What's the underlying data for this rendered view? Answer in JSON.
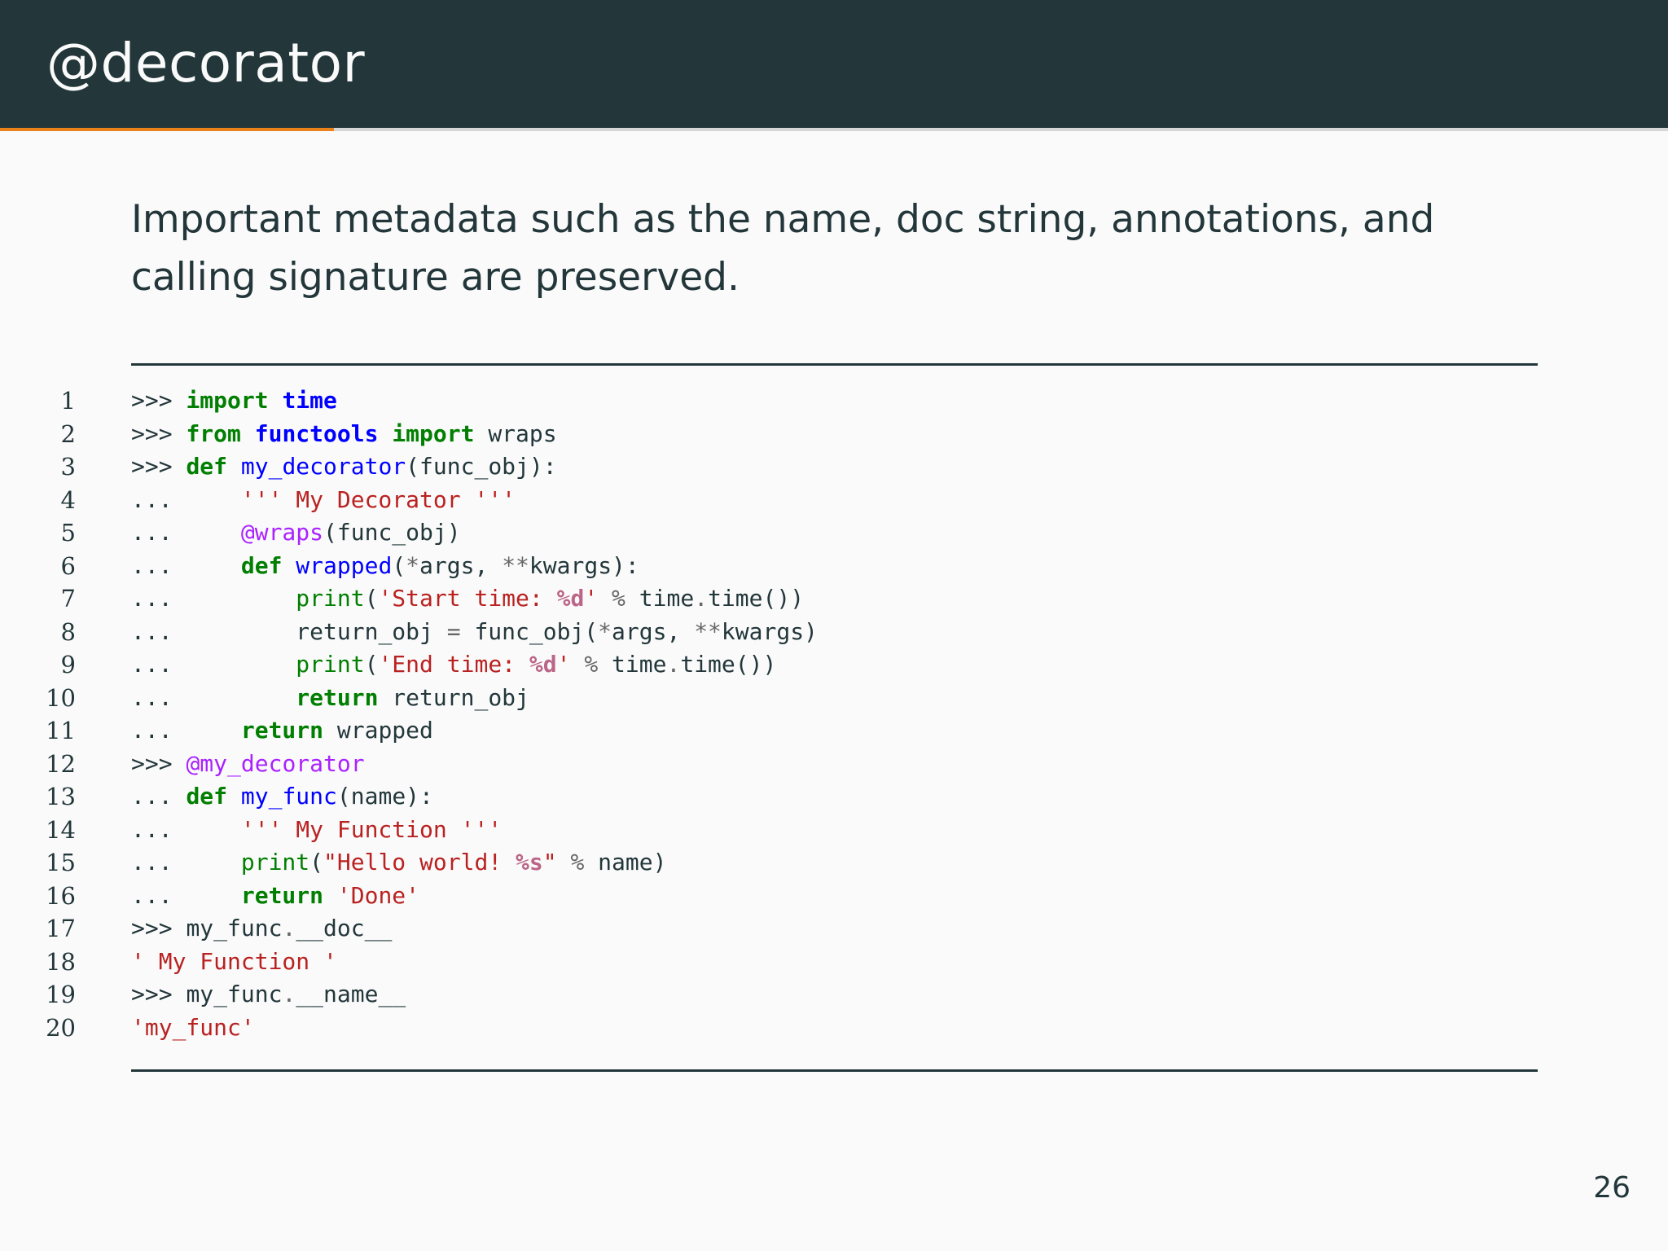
{
  "slide": {
    "title": "@decorator",
    "body_text": "Important metadata such as the name, doc string, annotations, and calling signature are preserved.",
    "page_number": "26",
    "progress_fraction": 0.2
  },
  "colors": {
    "header_bg": "#23373b",
    "accent": "#eb811b",
    "background": "#fafafa",
    "keyword": "#007f00",
    "function_name": "#0000ff",
    "string": "#ba2121",
    "decorator": "#aa22ff"
  },
  "code": {
    "language": "python",
    "lines": [
      {
        "number": "1",
        "tokens": [
          {
            "t": "prompt",
            "v": ">>> "
          },
          {
            "t": "kw",
            "v": "import"
          },
          {
            "t": "plain",
            "v": " "
          },
          {
            "t": "mod",
            "v": "time"
          }
        ]
      },
      {
        "number": "2",
        "tokens": [
          {
            "t": "prompt",
            "v": ">>> "
          },
          {
            "t": "kw",
            "v": "from"
          },
          {
            "t": "plain",
            "v": " "
          },
          {
            "t": "mod",
            "v": "functools"
          },
          {
            "t": "plain",
            "v": " "
          },
          {
            "t": "kw",
            "v": "import"
          },
          {
            "t": "plain",
            "v": " wraps"
          }
        ]
      },
      {
        "number": "3",
        "tokens": [
          {
            "t": "prompt",
            "v": ">>> "
          },
          {
            "t": "kw",
            "v": "def"
          },
          {
            "t": "plain",
            "v": " "
          },
          {
            "t": "fn",
            "v": "my_decorator"
          },
          {
            "t": "plain",
            "v": "(func_obj):"
          }
        ]
      },
      {
        "number": "4",
        "tokens": [
          {
            "t": "prompt",
            "v": "...     "
          },
          {
            "t": "str",
            "v": "''' My Decorator '''"
          }
        ]
      },
      {
        "number": "5",
        "tokens": [
          {
            "t": "prompt",
            "v": "...     "
          },
          {
            "t": "deco",
            "v": "@wraps"
          },
          {
            "t": "plain",
            "v": "(func_obj)"
          }
        ]
      },
      {
        "number": "6",
        "tokens": [
          {
            "t": "prompt",
            "v": "...     "
          },
          {
            "t": "kw",
            "v": "def"
          },
          {
            "t": "plain",
            "v": " "
          },
          {
            "t": "fn",
            "v": "wrapped"
          },
          {
            "t": "plain",
            "v": "("
          },
          {
            "t": "op",
            "v": "*"
          },
          {
            "t": "plain",
            "v": "args, "
          },
          {
            "t": "op",
            "v": "**"
          },
          {
            "t": "plain",
            "v": "kwargs):"
          }
        ]
      },
      {
        "number": "7",
        "tokens": [
          {
            "t": "prompt",
            "v": "...         "
          },
          {
            "t": "bi",
            "v": "print"
          },
          {
            "t": "plain",
            "v": "("
          },
          {
            "t": "str",
            "v": "'Start time: "
          },
          {
            "t": "strfmt",
            "v": "%d"
          },
          {
            "t": "str",
            "v": "'"
          },
          {
            "t": "plain",
            "v": " "
          },
          {
            "t": "op",
            "v": "%"
          },
          {
            "t": "plain",
            "v": " time"
          },
          {
            "t": "op",
            "v": "."
          },
          {
            "t": "plain",
            "v": "time())"
          }
        ]
      },
      {
        "number": "8",
        "tokens": [
          {
            "t": "prompt",
            "v": "...         "
          },
          {
            "t": "plain",
            "v": "return_obj "
          },
          {
            "t": "op",
            "v": "="
          },
          {
            "t": "plain",
            "v": " func_obj("
          },
          {
            "t": "op",
            "v": "*"
          },
          {
            "t": "plain",
            "v": "args, "
          },
          {
            "t": "op",
            "v": "**"
          },
          {
            "t": "plain",
            "v": "kwargs)"
          }
        ]
      },
      {
        "number": "9",
        "tokens": [
          {
            "t": "prompt",
            "v": "...         "
          },
          {
            "t": "bi",
            "v": "print"
          },
          {
            "t": "plain",
            "v": "("
          },
          {
            "t": "str",
            "v": "'End time: "
          },
          {
            "t": "strfmt",
            "v": "%d"
          },
          {
            "t": "str",
            "v": "'"
          },
          {
            "t": "plain",
            "v": " "
          },
          {
            "t": "op",
            "v": "%"
          },
          {
            "t": "plain",
            "v": " time"
          },
          {
            "t": "op",
            "v": "."
          },
          {
            "t": "plain",
            "v": "time())"
          }
        ]
      },
      {
        "number": "10",
        "tokens": [
          {
            "t": "prompt",
            "v": "...         "
          },
          {
            "t": "kw",
            "v": "return"
          },
          {
            "t": "plain",
            "v": " return_obj"
          }
        ]
      },
      {
        "number": "11",
        "tokens": [
          {
            "t": "prompt",
            "v": "...     "
          },
          {
            "t": "kw",
            "v": "return"
          },
          {
            "t": "plain",
            "v": " wrapped"
          }
        ]
      },
      {
        "number": "12",
        "tokens": [
          {
            "t": "prompt",
            "v": ">>> "
          },
          {
            "t": "deco",
            "v": "@my_decorator"
          }
        ]
      },
      {
        "number": "13",
        "tokens": [
          {
            "t": "prompt",
            "v": "... "
          },
          {
            "t": "kw",
            "v": "def"
          },
          {
            "t": "plain",
            "v": " "
          },
          {
            "t": "fn",
            "v": "my_func"
          },
          {
            "t": "plain",
            "v": "(name):"
          }
        ]
      },
      {
        "number": "14",
        "tokens": [
          {
            "t": "prompt",
            "v": "...     "
          },
          {
            "t": "str",
            "v": "''' My Function '''"
          }
        ]
      },
      {
        "number": "15",
        "tokens": [
          {
            "t": "prompt",
            "v": "...     "
          },
          {
            "t": "bi",
            "v": "print"
          },
          {
            "t": "plain",
            "v": "("
          },
          {
            "t": "str",
            "v": "\"Hello world! "
          },
          {
            "t": "strfmt",
            "v": "%s"
          },
          {
            "t": "str",
            "v": "\""
          },
          {
            "t": "plain",
            "v": " "
          },
          {
            "t": "op",
            "v": "%"
          },
          {
            "t": "plain",
            "v": " name)"
          }
        ]
      },
      {
        "number": "16",
        "tokens": [
          {
            "t": "prompt",
            "v": "...     "
          },
          {
            "t": "kw",
            "v": "return"
          },
          {
            "t": "plain",
            "v": " "
          },
          {
            "t": "str",
            "v": "'Done'"
          }
        ]
      },
      {
        "number": "17",
        "tokens": [
          {
            "t": "prompt",
            "v": ">>> "
          },
          {
            "t": "plain",
            "v": "my_func"
          },
          {
            "t": "op",
            "v": "."
          },
          {
            "t": "plain",
            "v": "__doc__"
          }
        ]
      },
      {
        "number": "18",
        "tokens": [
          {
            "t": "str",
            "v": "' My Function '"
          }
        ]
      },
      {
        "number": "19",
        "tokens": [
          {
            "t": "prompt",
            "v": ">>> "
          },
          {
            "t": "plain",
            "v": "my_func"
          },
          {
            "t": "op",
            "v": "."
          },
          {
            "t": "plain",
            "v": "__name__"
          }
        ]
      },
      {
        "number": "20",
        "tokens": [
          {
            "t": "str",
            "v": "'my_func'"
          }
        ]
      }
    ]
  }
}
